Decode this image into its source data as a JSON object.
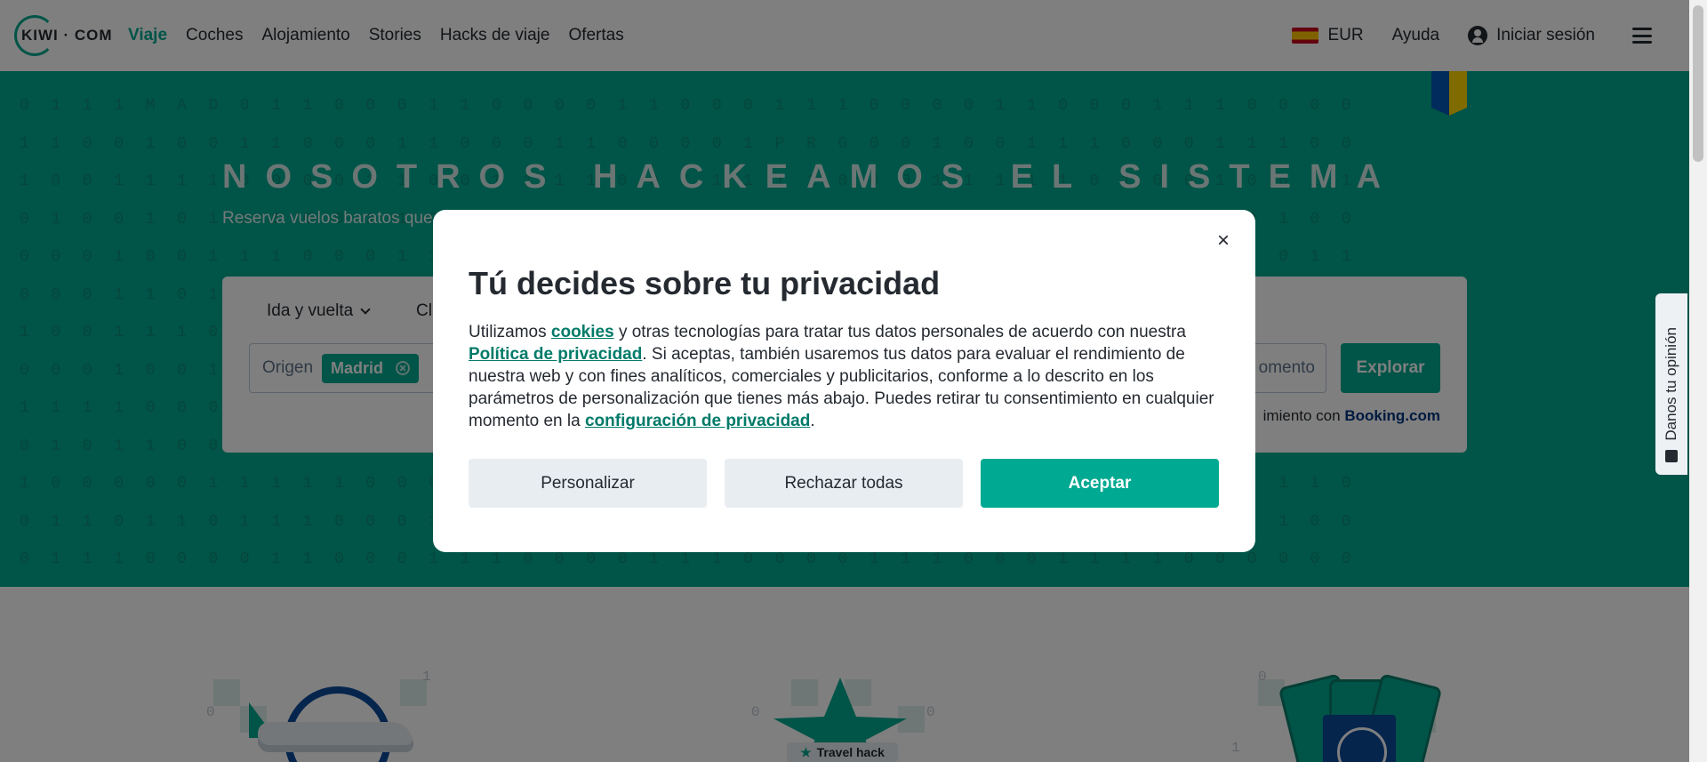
{
  "header": {
    "logo_text": "KIWI · COM",
    "nav": [
      {
        "label": "Viaje",
        "active": true
      },
      {
        "label": "Coches"
      },
      {
        "label": "Alojamiento"
      },
      {
        "label": "Stories"
      },
      {
        "label": "Hacks de viaje"
      },
      {
        "label": "Ofertas"
      }
    ],
    "currency": "EUR",
    "help": "Ayuda",
    "signin": "Iniciar sesión"
  },
  "hero": {
    "digit_rows": [
      "0 1 1 1 M A D 0 1 1 0 0 0 1 1 0 0 0 0 1 1 0 0 0 1 1 1 0 0 0 0 1 1 0 0 0 1 1 1 0 0 0 0",
      "1 1 0 0 1 0 0 1 1 0 0 0 1 1 0 0 0 1 1 0 0 0 0 1 P R G 0 0 1 0 0 1 1 1 0 0 0 1 1 1 0 0",
      "1 0 0 1 1 1 1 0 0 0 0 1 1 0 0 1 1 1 1 0 0 1 1 1 1 1 0 0 0 1 1 1 1 1 0 1 0 0 1 0 0 1 1",
      "0 1 0 0 1 0 1 1 1 0 0 1 1 0 0 0 1 1 1 1 0 0 0 0 1 0 0 0 1 1 0 0 1 1 0 1 0 0 1 0 1 0 0",
      "0 0 0 1 0 0 1 1 1 0 0 0 1 1 0 0 1 1 1 0 0 0 0 1 1 1 0 0 0 1 0 0 0 0 1 0 0 0 1 0 0 1 1",
      "0 0 0 1 1 0 1 1 0 0 0 1 1 1 0 0 1 1 0 0 0 0 1 1 1 0 0 1 1 0 0 0 0 1 1 1 0 0 0 1 1 0 0",
      "1 0 0 1 1 1 0 0 0 1 1 0 0 0 1 1 1 0 0 0 1 1 1 0 0 0 1 1 0 0 0 1 1 1 1 0 0 0 1 0 0 1 1",
      "0 0 0 1 0 0 1 1 0 0 1 1 1 0 0 0 1 1 0 0 0 1 1 0 0 0 0 1 1 1 0 0 0 1 1 0 0 0 1 0 0 1 0",
      "1 1 1 1 0 0 0 1 1 1 0 0 0 1 1 0 0 0 1 1 1 0 0 0 1 1 0 0 0 1 1 1 0 0 0 1 1 1 0 0 0 1 1",
      "0 1 0 1 1 0 0 1 1 0 0 0 1 1 1 0 0 1 1 0 0 0 1 1 1 0 0 0 1 1 0 0 0 1 1 1 1 1 1 1 0 1 1",
      "1 0 0 0 0 0 1 1 1 1 1 0 0 0 1 1 0 0 0 1 1 1 1 0 0 0 1 1 1 0 0 1 1 0 0 0 1 0 0 0 1 1 0",
      "0 1 1 0 1 1 0 1 1 1 0 0 0 1 1 0 0 0 1 1 1 0 0 1 1 0 0 0 1 1 1 0 0 0 1 1 0 0 1 1 1 0 0",
      "0 1 1 1 0 0 0 0 1 1 0 0 0 1 1 1 0 0 0 0 1 1 1 0 0 0 0 1 1 1 0 0 0 1 1 1 1 0 0 0 0 0 0"
    ],
    "title": "NOSOTROS HACKEAMOS EL SISTEMA",
    "subtitle": "Reserva vuelos baratos que",
    "trip_type": "Ida y vuelta",
    "cabin_partial": "Cl",
    "origin_label": "Origen",
    "origin_value": "Madrid",
    "date_partial": "omento",
    "explore_button": "Explorar",
    "booking_prefix": "imiento con",
    "booking_brand": "Booking.com"
  },
  "feedback_tab": "Danos tu opinión",
  "features": {
    "travel_hack_badge": "Travel hack"
  },
  "modal": {
    "title": "Tú decides sobre tu privacidad",
    "body": {
      "t1": "Utilizamos ",
      "link1": "cookies",
      "t2": " y otras tecnologías para tratar tus datos personales de acuerdo con nuestra ",
      "link2": "Política de privacidad",
      "t3": ". Si aceptas, también usaremos tus datos para evaluar el rendimiento de nuestra web y con fines analíticos, comerciales y publicitarios, conforme a lo descrito en los parámetros de personalización que tienes más abajo. Puedes retirar tu consentimiento en cualquier momento en la ",
      "link3": "configuración de privacidad",
      "t4": "."
    },
    "buttons": {
      "customize": "Personalizar",
      "reject": "Rechazar todas",
      "accept": "Aceptar"
    },
    "close_glyph": "×"
  },
  "colors": {
    "brand": "#00a991",
    "link": "#007a69",
    "text": "#252a31"
  }
}
